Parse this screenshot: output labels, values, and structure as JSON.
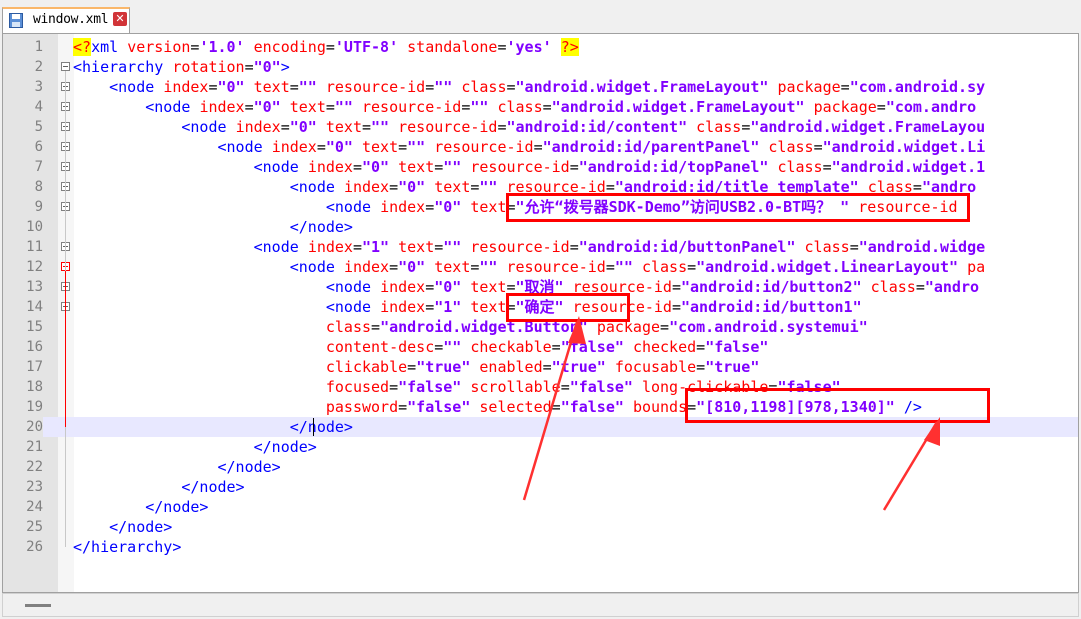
{
  "tab": {
    "label": "window.xml",
    "close": "✕"
  },
  "editor": {
    "lines": [
      {
        "n": "1",
        "code": [
          [
            "pi",
            "<?"
          ],
          [
            "t",
            "xml "
          ],
          [
            "a",
            "version"
          ],
          [
            "pl",
            "="
          ],
          [
            "v",
            "'1.0' "
          ],
          [
            "a",
            "encoding"
          ],
          [
            "pl",
            "="
          ],
          [
            "v",
            "'UTF-8' "
          ],
          [
            "a",
            "standalone"
          ],
          [
            "pl",
            "="
          ],
          [
            "v",
            "'yes' "
          ],
          [
            "pi",
            "?>"
          ]
        ]
      },
      {
        "n": "2",
        "code": [
          [
            "t",
            "<hierarchy "
          ],
          [
            "a",
            "rotation"
          ],
          [
            "pl",
            "="
          ],
          [
            "v",
            "\"0\""
          ],
          [
            "t",
            ">"
          ]
        ]
      },
      {
        "n": "3",
        "code": [
          [
            "pl",
            "    "
          ],
          [
            "t",
            "<node "
          ],
          [
            "a",
            "index"
          ],
          [
            "pl",
            "="
          ],
          [
            "v",
            "\"0\" "
          ],
          [
            "a",
            "text"
          ],
          [
            "pl",
            "="
          ],
          [
            "v",
            "\"\" "
          ],
          [
            "a",
            "resource-id"
          ],
          [
            "pl",
            "="
          ],
          [
            "v",
            "\"\" "
          ],
          [
            "a",
            "class"
          ],
          [
            "pl",
            "="
          ],
          [
            "v",
            "\"android.widget.FrameLayout\" "
          ],
          [
            "a",
            "package"
          ],
          [
            "pl",
            "="
          ],
          [
            "v",
            "\"com.android.sy"
          ]
        ]
      },
      {
        "n": "4",
        "code": [
          [
            "pl",
            "        "
          ],
          [
            "t",
            "<node "
          ],
          [
            "a",
            "index"
          ],
          [
            "pl",
            "="
          ],
          [
            "v",
            "\"0\" "
          ],
          [
            "a",
            "text"
          ],
          [
            "pl",
            "="
          ],
          [
            "v",
            "\"\" "
          ],
          [
            "a",
            "resource-id"
          ],
          [
            "pl",
            "="
          ],
          [
            "v",
            "\"\" "
          ],
          [
            "a",
            "class"
          ],
          [
            "pl",
            "="
          ],
          [
            "v",
            "\"android.widget.FrameLayout\" "
          ],
          [
            "a",
            "package"
          ],
          [
            "pl",
            "="
          ],
          [
            "v",
            "\"com.andro"
          ]
        ]
      },
      {
        "n": "5",
        "code": [
          [
            "pl",
            "            "
          ],
          [
            "t",
            "<node "
          ],
          [
            "a",
            "index"
          ],
          [
            "pl",
            "="
          ],
          [
            "v",
            "\"0\" "
          ],
          [
            "a",
            "text"
          ],
          [
            "pl",
            "="
          ],
          [
            "v",
            "\"\" "
          ],
          [
            "a",
            "resource-id"
          ],
          [
            "pl",
            "="
          ],
          [
            "v",
            "\"android:id/content\" "
          ],
          [
            "a",
            "class"
          ],
          [
            "pl",
            "="
          ],
          [
            "v",
            "\"android.widget.FrameLayou"
          ]
        ]
      },
      {
        "n": "6",
        "code": [
          [
            "pl",
            "                "
          ],
          [
            "t",
            "<node "
          ],
          [
            "a",
            "index"
          ],
          [
            "pl",
            "="
          ],
          [
            "v",
            "\"0\" "
          ],
          [
            "a",
            "text"
          ],
          [
            "pl",
            "="
          ],
          [
            "v",
            "\"\" "
          ],
          [
            "a",
            "resource-id"
          ],
          [
            "pl",
            "="
          ],
          [
            "v",
            "\"android:id/parentPanel\" "
          ],
          [
            "a",
            "class"
          ],
          [
            "pl",
            "="
          ],
          [
            "v",
            "\"android.widget.Li"
          ]
        ]
      },
      {
        "n": "7",
        "code": [
          [
            "pl",
            "                    "
          ],
          [
            "t",
            "<node "
          ],
          [
            "a",
            "index"
          ],
          [
            "pl",
            "="
          ],
          [
            "v",
            "\"0\" "
          ],
          [
            "a",
            "text"
          ],
          [
            "pl",
            "="
          ],
          [
            "v",
            "\"\" "
          ],
          [
            "a",
            "resource-id"
          ],
          [
            "pl",
            "="
          ],
          [
            "v",
            "\"android:id/topPanel\" "
          ],
          [
            "a",
            "class"
          ],
          [
            "pl",
            "="
          ],
          [
            "v",
            "\"android.widget.1"
          ]
        ]
      },
      {
        "n": "8",
        "code": [
          [
            "pl",
            "                        "
          ],
          [
            "t",
            "<node "
          ],
          [
            "a",
            "index"
          ],
          [
            "pl",
            "="
          ],
          [
            "v",
            "\"0\" "
          ],
          [
            "a",
            "text"
          ],
          [
            "pl",
            "="
          ],
          [
            "v",
            "\"\" "
          ],
          [
            "a",
            "resource-id"
          ],
          [
            "pl",
            "="
          ],
          [
            "v",
            "\"android:id/title_template\" "
          ],
          [
            "a",
            "class"
          ],
          [
            "pl",
            "="
          ],
          [
            "v",
            "\"andro"
          ]
        ]
      },
      {
        "n": "9",
        "code": [
          [
            "pl",
            "                            "
          ],
          [
            "t",
            "<node "
          ],
          [
            "a",
            "index"
          ],
          [
            "pl",
            "="
          ],
          [
            "v",
            "\"0\" "
          ],
          [
            "a",
            "text"
          ],
          [
            "pl",
            "="
          ],
          [
            "v",
            "\"允许“拨号器SDK-Demo”访问USB2.0-BT吗？ \" "
          ],
          [
            "a",
            "resource-id"
          ]
        ]
      },
      {
        "n": "10",
        "code": [
          [
            "pl",
            "                        "
          ],
          [
            "t",
            "</node>"
          ]
        ]
      },
      {
        "n": "11",
        "code": [
          [
            "pl",
            "                    "
          ],
          [
            "t",
            "<node "
          ],
          [
            "a",
            "index"
          ],
          [
            "pl",
            "="
          ],
          [
            "v",
            "\"1\" "
          ],
          [
            "a",
            "text"
          ],
          [
            "pl",
            "="
          ],
          [
            "v",
            "\"\" "
          ],
          [
            "a",
            "resource-id"
          ],
          [
            "pl",
            "="
          ],
          [
            "v",
            "\"android:id/buttonPanel\" "
          ],
          [
            "a",
            "class"
          ],
          [
            "pl",
            "="
          ],
          [
            "v",
            "\"android.widge"
          ]
        ]
      },
      {
        "n": "12",
        "code": [
          [
            "pl",
            "                        "
          ],
          [
            "t",
            "<node "
          ],
          [
            "a",
            "index"
          ],
          [
            "pl",
            "="
          ],
          [
            "v",
            "\"0\" "
          ],
          [
            "a",
            "text"
          ],
          [
            "pl",
            "="
          ],
          [
            "v",
            "\"\" "
          ],
          [
            "a",
            "resource-id"
          ],
          [
            "pl",
            "="
          ],
          [
            "v",
            "\"\" "
          ],
          [
            "a",
            "class"
          ],
          [
            "pl",
            "="
          ],
          [
            "v",
            "\"android.widget.LinearLayout\" "
          ],
          [
            "a",
            "pa"
          ]
        ]
      },
      {
        "n": "13",
        "code": [
          [
            "pl",
            "                            "
          ],
          [
            "t",
            "<node "
          ],
          [
            "a",
            "index"
          ],
          [
            "pl",
            "="
          ],
          [
            "v",
            "\"0\" "
          ],
          [
            "a",
            "text"
          ],
          [
            "pl",
            "="
          ],
          [
            "v",
            "\"取消\" "
          ],
          [
            "a",
            "resource-id"
          ],
          [
            "pl",
            "="
          ],
          [
            "v",
            "\"android:id/button2\" "
          ],
          [
            "a",
            "class"
          ],
          [
            "pl",
            "="
          ],
          [
            "v",
            "\"andro"
          ]
        ]
      },
      {
        "n": "14",
        "code": [
          [
            "pl",
            "                            "
          ],
          [
            "t",
            "<node "
          ],
          [
            "a",
            "index"
          ],
          [
            "pl",
            "="
          ],
          [
            "v",
            "\"1\" "
          ],
          [
            "a",
            "text"
          ],
          [
            "pl",
            "="
          ],
          [
            "v",
            "\"确定\" "
          ],
          [
            "a",
            "resource-id"
          ],
          [
            "pl",
            "="
          ],
          [
            "v",
            "\"android:id/button1\""
          ]
        ]
      },
      {
        "n": "15",
        "code": [
          [
            "pl",
            "                            "
          ],
          [
            "a",
            "class"
          ],
          [
            "pl",
            "="
          ],
          [
            "v",
            "\"android.widget.Button\" "
          ],
          [
            "a",
            "package"
          ],
          [
            "pl",
            "="
          ],
          [
            "v",
            "\"com.android.systemui\""
          ]
        ]
      },
      {
        "n": "16",
        "code": [
          [
            "pl",
            "                            "
          ],
          [
            "a",
            "content-desc"
          ],
          [
            "pl",
            "="
          ],
          [
            "v",
            "\"\" "
          ],
          [
            "a",
            "checkable"
          ],
          [
            "pl",
            "="
          ],
          [
            "v",
            "\"false\" "
          ],
          [
            "a",
            "checked"
          ],
          [
            "pl",
            "="
          ],
          [
            "v",
            "\"false\""
          ]
        ]
      },
      {
        "n": "17",
        "code": [
          [
            "pl",
            "                            "
          ],
          [
            "a",
            "clickable"
          ],
          [
            "pl",
            "="
          ],
          [
            "v",
            "\"true\" "
          ],
          [
            "a",
            "enabled"
          ],
          [
            "pl",
            "="
          ],
          [
            "v",
            "\"true\" "
          ],
          [
            "a",
            "focusable"
          ],
          [
            "pl",
            "="
          ],
          [
            "v",
            "\"true\""
          ]
        ]
      },
      {
        "n": "18",
        "code": [
          [
            "pl",
            "                            "
          ],
          [
            "a",
            "focused"
          ],
          [
            "pl",
            "="
          ],
          [
            "v",
            "\"false\" "
          ],
          [
            "a",
            "scrollable"
          ],
          [
            "pl",
            "="
          ],
          [
            "v",
            "\"false\" "
          ],
          [
            "a",
            "long-clickable"
          ],
          [
            "pl",
            "="
          ],
          [
            "v",
            "\"false\""
          ]
        ]
      },
      {
        "n": "19",
        "code": [
          [
            "pl",
            "                            "
          ],
          [
            "a",
            "password"
          ],
          [
            "pl",
            "="
          ],
          [
            "v",
            "\"false\" "
          ],
          [
            "a",
            "selected"
          ],
          [
            "pl",
            "="
          ],
          [
            "v",
            "\"false\" "
          ],
          [
            "a",
            "bounds"
          ],
          [
            "pl",
            "="
          ],
          [
            "v",
            "\"[810,1198][978,1340]\" "
          ],
          [
            "t",
            "/>"
          ]
        ]
      },
      {
        "n": "20",
        "code": [
          [
            "pl",
            "                        "
          ],
          [
            "t",
            "</node>"
          ]
        ]
      },
      {
        "n": "21",
        "code": [
          [
            "pl",
            "                    "
          ],
          [
            "t",
            "</node>"
          ]
        ]
      },
      {
        "n": "22",
        "code": [
          [
            "pl",
            "                "
          ],
          [
            "t",
            "</node>"
          ]
        ]
      },
      {
        "n": "23",
        "code": [
          [
            "pl",
            "            "
          ],
          [
            "t",
            "</node>"
          ]
        ]
      },
      {
        "n": "24",
        "code": [
          [
            "pl",
            "        "
          ],
          [
            "t",
            "</node>"
          ]
        ]
      },
      {
        "n": "25",
        "code": [
          [
            "pl",
            "    "
          ],
          [
            "t",
            "</node>"
          ]
        ]
      },
      {
        "n": "26",
        "code": [
          [
            "t",
            "</hierarchy>"
          ]
        ]
      }
    ]
  }
}
